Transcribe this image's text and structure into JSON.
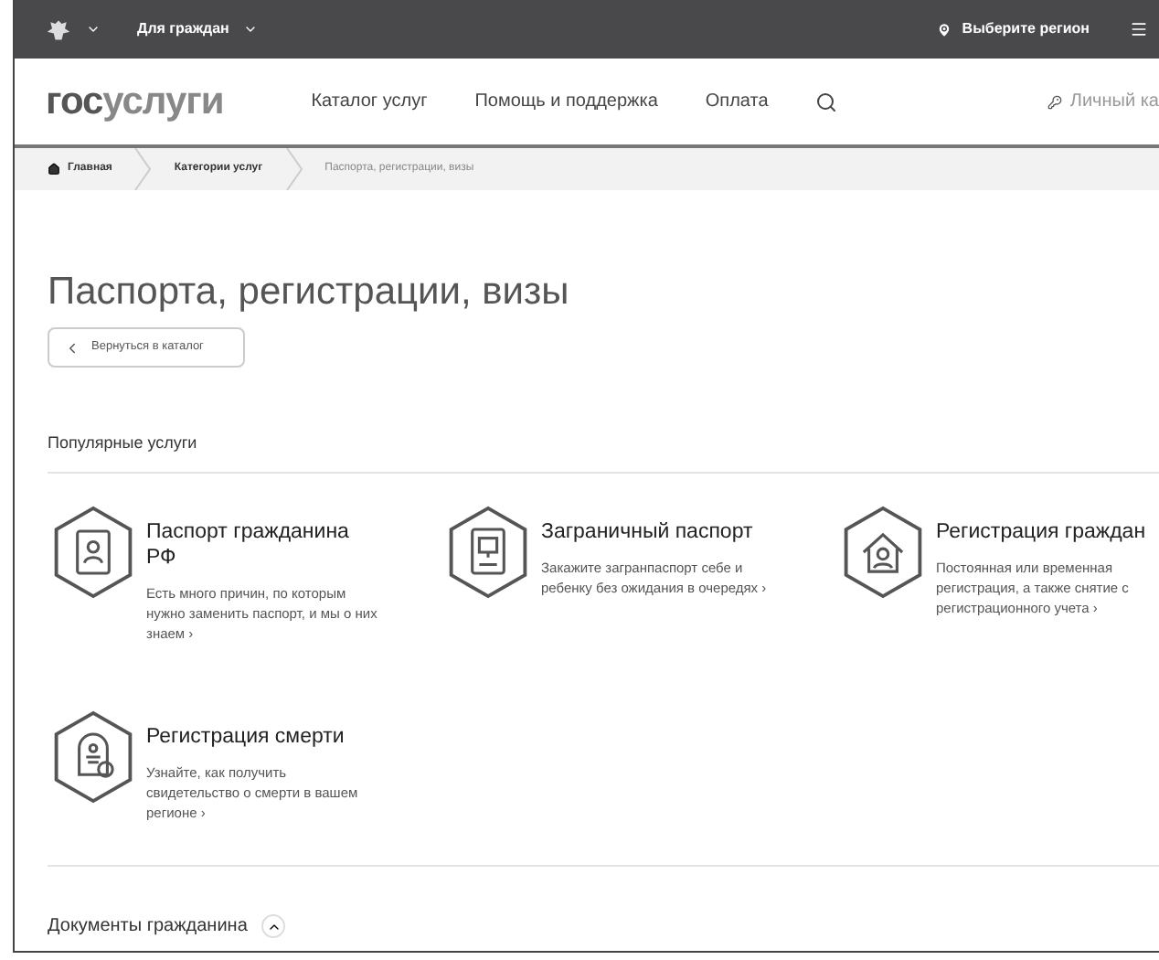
{
  "top_bar": {
    "menu_label": "Для граждан",
    "region": "Выберите регион"
  },
  "header": {
    "logo": {
      "dark_part": "гос",
      "light_part": "услуги"
    },
    "nav": [
      "Каталог услуг",
      "Помощь и поддержка",
      "Оплата"
    ],
    "account": "Личный ка"
  },
  "breadcrumbs": [
    "Главная",
    "Категории услуг",
    "Паспорта, регистрации, визы"
  ],
  "title": "Паспорта, регистрации, визы",
  "back_button": "Вернуться в каталог",
  "popular": {
    "heading": "Популярные услуги",
    "services": [
      {
        "kind": "id-card",
        "title": "Паспорт гражданина РФ",
        "description": "Есть много причин, по которым нужно заменить паспорт, и мы о них знаем ›"
      },
      {
        "kind": "passport",
        "title": "Заграничный паспорт",
        "description": "Закажите загранпаспорт себе и ребенку без ожидания в очередях ›"
      },
      {
        "kind": "house",
        "title": "Регистрация граждан",
        "description": "Постоянная или временная регистрация, а также снятие с регистрационного учета ›"
      },
      {
        "kind": "certificate",
        "title": "Регистрация смерти",
        "description": "Узнайте, как получить свидетельство о смерти в вашем регионе ›"
      }
    ]
  },
  "section": {
    "title": "Документы гражданина",
    "expanded": true
  }
}
